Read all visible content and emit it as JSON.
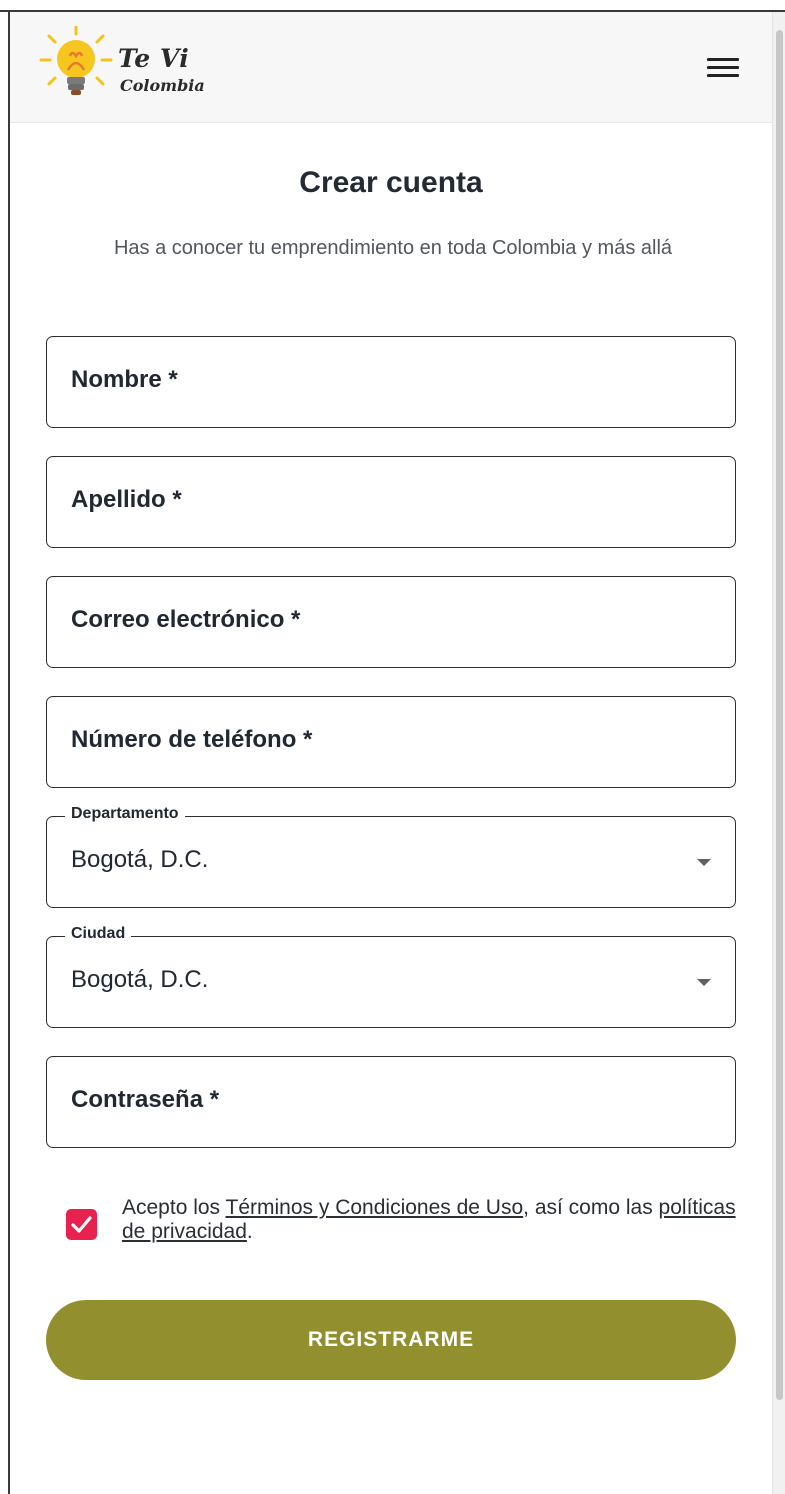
{
  "header": {
    "logo_line1": "Te Vi",
    "logo_line2": "Colombia"
  },
  "page": {
    "title": "Crear cuenta",
    "subtitle": "Has a conocer tu emprendimiento en toda Colombia y más allá"
  },
  "form": {
    "nombre_label": "Nombre *",
    "apellido_label": "Apellido *",
    "correo_label": "Correo electrónico *",
    "telefono_label": "Número de teléfono *",
    "departamento": {
      "legend": "Departamento",
      "value": "Bogotá, D.C."
    },
    "ciudad": {
      "legend": "Ciudad",
      "value": "Bogotá, D.C."
    },
    "contrasena_label": "Contraseña *",
    "terms": {
      "checked": true,
      "prefix": "Acepto los ",
      "terms_link": "Términos y Condiciones de Uso",
      "middle": ", así como las ",
      "privacy_link": "políticas de privacidad",
      "suffix": "."
    },
    "submit_label": "REGISTRARME"
  },
  "colors": {
    "accent_button": "#928f2e",
    "checkbox": "#e8224f",
    "logo_bulb": "#f5c21b"
  },
  "icons": {
    "logo": "lightbulb-logo-icon",
    "menu": "hamburger-menu-icon",
    "select_caret": "caret-down-icon",
    "checkbox": "checkmark-icon"
  }
}
